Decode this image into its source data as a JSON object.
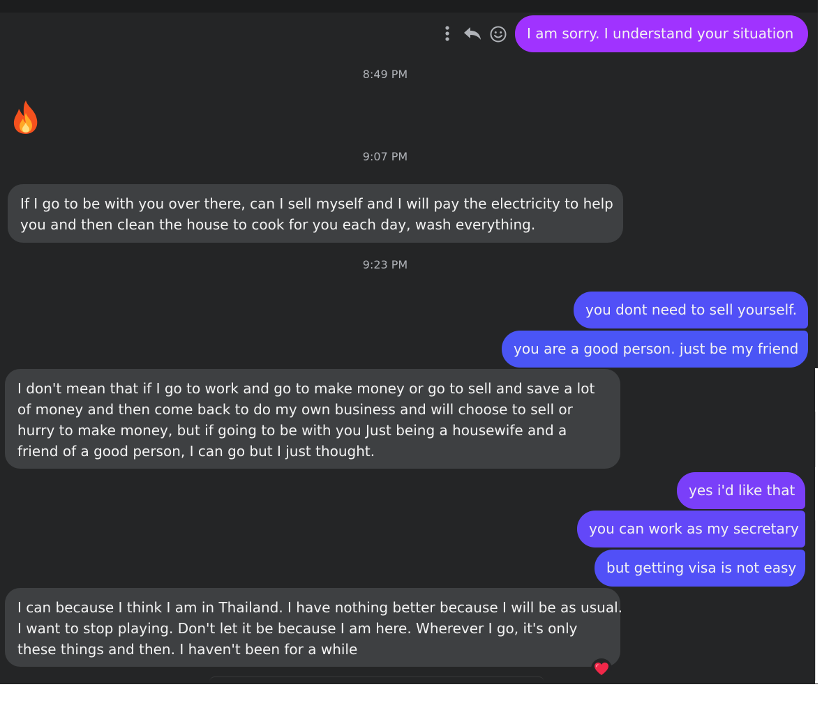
{
  "messages": {
    "m1": "I am sorry.  I understand your situation",
    "m2_emoji": "🔥",
    "m3_line1": "If I go to be with you over there, can I sell myself and I will pay the electricity to help",
    "m3_line2": "you and then clean the house to cook for you each day, wash everything.",
    "m4": "you dont need to sell yourself.",
    "m5": "you are a good person. just be my friend",
    "m6_line1": "I don't mean that if I go to work and go to make money or go to sell and save a lot",
    "m6_line2": "of money and then come back to do my own business and will choose to sell or",
    "m6_line3": "hurry to make money, but if going to be with you  Just being a housewife and a",
    "m6_line4": "friend of a good person, I can go but I just thought.",
    "m7": "yes i'd like that",
    "m8": "you can work as my secretary",
    "m9": "but getting visa is not easy",
    "m10_line1": "I can because I think I am in Thailand. I have nothing better because I will be as usual.",
    "m10_line2": "I want to stop playing. Don't let it be because I am here. Wherever I go, it's only",
    "m10_line3": "these things and then. I haven't been for a while",
    "m10_reaction": "❤"
  },
  "timestamps": {
    "t1": "8:49 PM",
    "t2": "9:07 PM",
    "t3": "9:23 PM"
  },
  "icons": {
    "more": "more-vertical-icon",
    "reply": "reply-icon",
    "react": "smiley-icon"
  },
  "colors": {
    "background": "#242526",
    "incoming_bubble": "#3e4042",
    "outgoing_top": "#a033ff",
    "outgoing_bottom": "#4a55f5"
  }
}
